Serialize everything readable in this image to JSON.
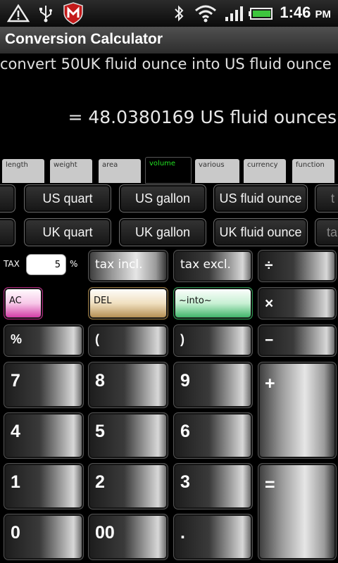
{
  "status_bar": {
    "time": "1:46",
    "ampm": "PM"
  },
  "app": {
    "title": "Conversion Calculator"
  },
  "display": {
    "query": "convert 50UK fluid ounce into US fluid ounce",
    "result": "= 48.0380169 US fluid ounces"
  },
  "tabs": [
    {
      "label": "length"
    },
    {
      "label": "weight"
    },
    {
      "label": "area"
    },
    {
      "label": "volume",
      "active": true
    },
    {
      "label": "various"
    },
    {
      "label": "currency"
    },
    {
      "label": "function"
    }
  ],
  "units": {
    "row1": [
      "US quart",
      "US gallon",
      "US fluid ounce",
      "t"
    ],
    "row2": [
      "UK quart",
      "UK gallon",
      "UK fluid ounce",
      "ta"
    ]
  },
  "tax": {
    "label": "TAX",
    "value": "5",
    "percent": "%",
    "incl_label": "tax incl.",
    "excl_label": "tax excl."
  },
  "keys": {
    "divide": "÷",
    "multiply": "×",
    "minus": "−",
    "plus": "+",
    "equals": "=",
    "ac": "AC",
    "del": "DEL",
    "into": "~into~",
    "percent": "%",
    "open_paren": "(",
    "close_paren": ")",
    "seven": "7",
    "eight": "8",
    "nine": "9",
    "four": "4",
    "five": "5",
    "six": "6",
    "one": "1",
    "two": "2",
    "three": "3",
    "zero": "0",
    "double_zero": "00",
    "dot": "."
  },
  "colors": {
    "active_tab_text": "#22e022",
    "ac_key": "#d030a0",
    "del_key": "#b0884a",
    "into_key": "#33b060"
  }
}
